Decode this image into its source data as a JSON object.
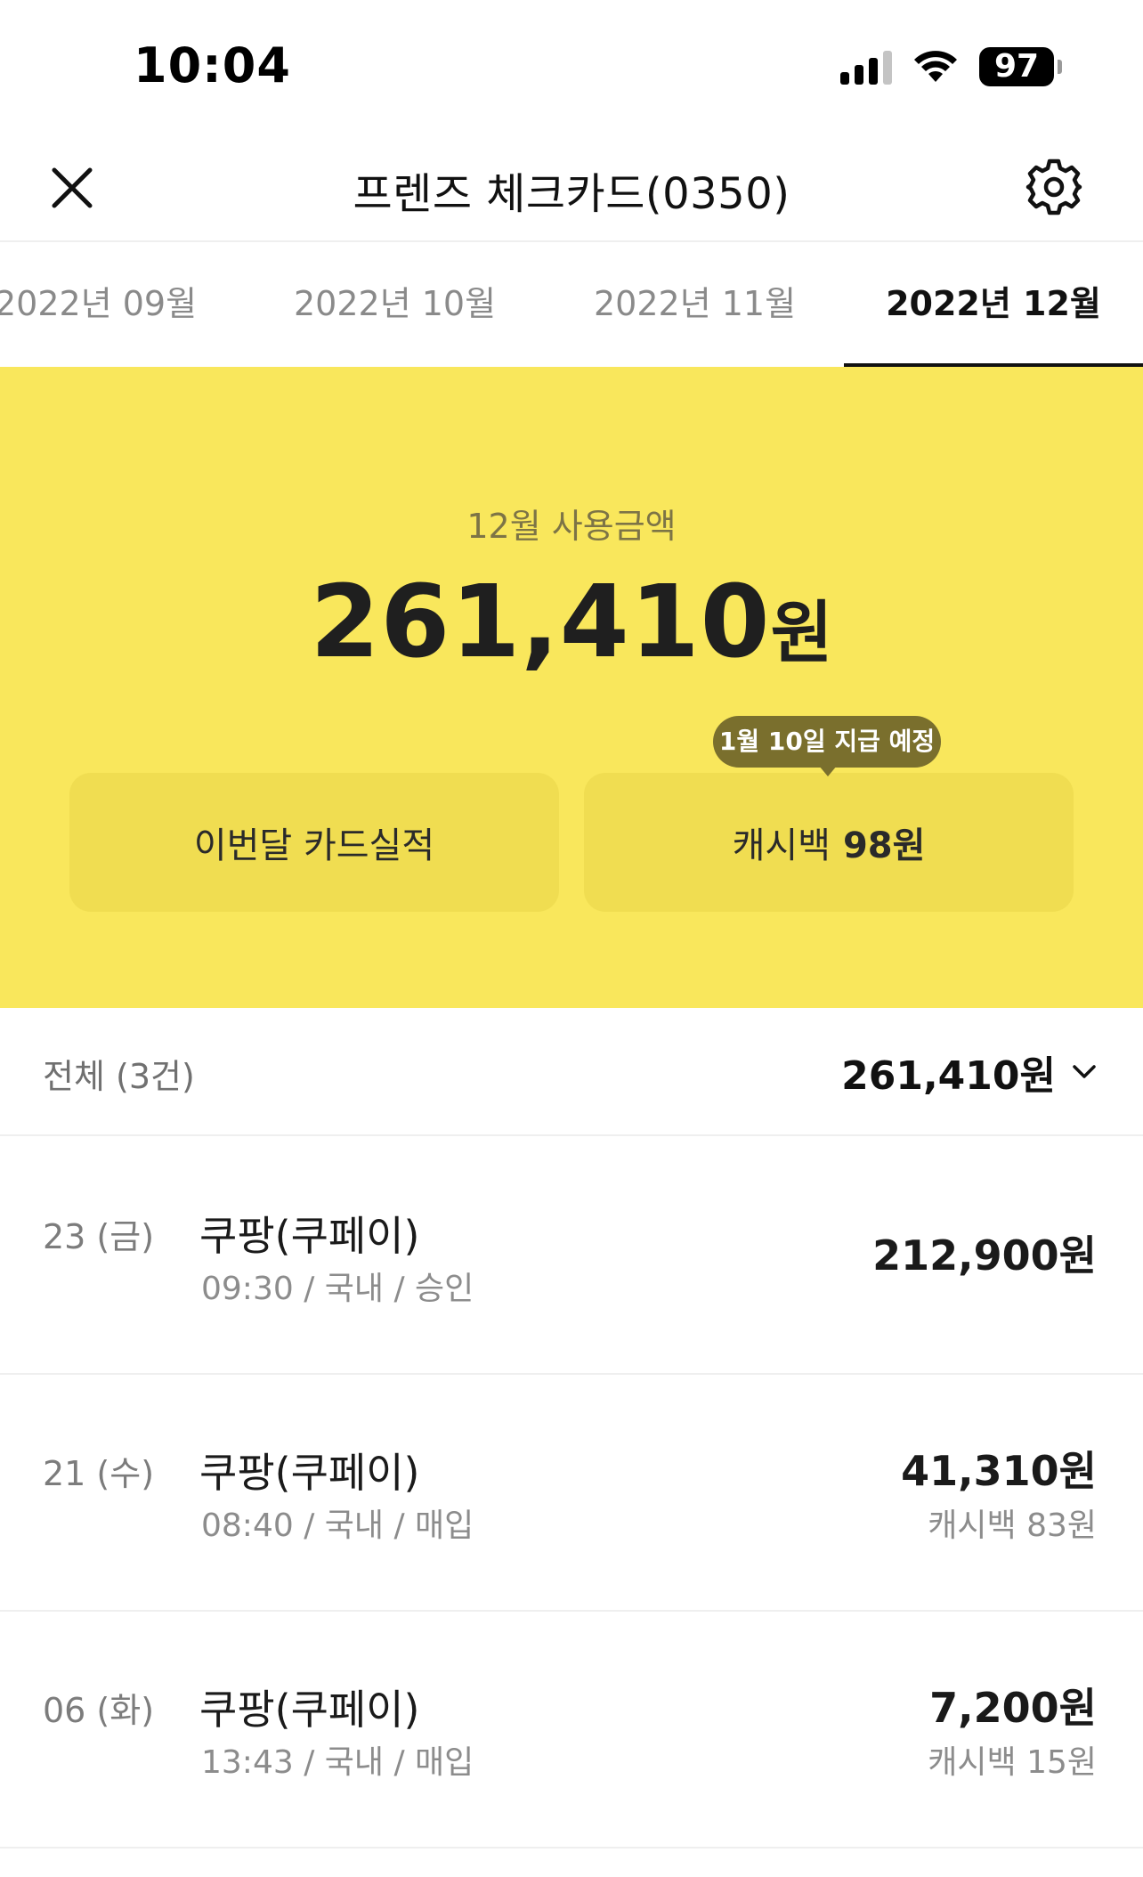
{
  "status_bar": {
    "time": "10:04",
    "battery": "97",
    "icons": [
      "cellular-signal-icon",
      "wifi-icon",
      "battery-icon"
    ]
  },
  "header": {
    "title": "프렌즈 체크카드(0350)",
    "close_icon": "close-icon",
    "settings_icon": "gear-icon"
  },
  "tabs": [
    {
      "label": "2022년 09월",
      "selected": false
    },
    {
      "label": "2022년 10월",
      "selected": false
    },
    {
      "label": "2022년 11월",
      "selected": false
    },
    {
      "label": "2022년 12월",
      "selected": true
    }
  ],
  "summary": {
    "label": "12월 사용금액",
    "amount": "261,410",
    "currency": "원",
    "performance_button": "이번달 카드실적",
    "cashback_label": "캐시백",
    "cashback_value": "98원",
    "cashback_tooltip": "1월 10일 지급 예정"
  },
  "list": {
    "count_label": "전체 (3건)",
    "total": "261,410원",
    "dropdown_icon": "chevron-down-icon"
  },
  "transactions": [
    {
      "date": "23 (금)",
      "merchant": "쿠팡(쿠페이)",
      "meta": "09:30 / 국내 / 승인",
      "amount": "212,900원",
      "cashback": ""
    },
    {
      "date": "21 (수)",
      "merchant": "쿠팡(쿠페이)",
      "meta": "08:40 / 국내 / 매입",
      "amount": "41,310원",
      "cashback": "캐시백 83원"
    },
    {
      "date": "06 (화)",
      "merchant": "쿠팡(쿠페이)",
      "meta": "13:43 / 국내 / 매입",
      "amount": "7,200원",
      "cashback": "캐시백 15원"
    }
  ],
  "colors": {
    "summary_background": "#f9e75c",
    "summary_button": "#f0dd51",
    "tooltip_background": "#7a6f2d",
    "text_primary": "#1a1a1a",
    "text_secondary": "#8c8c8c"
  }
}
